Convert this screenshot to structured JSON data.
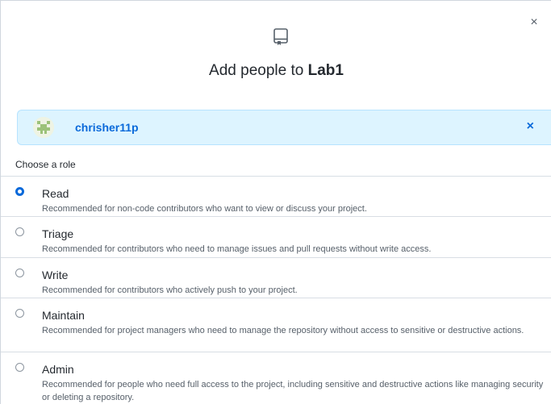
{
  "dialog": {
    "title_prefix": "Add people to ",
    "repo_name": "Lab1",
    "close_label": "×"
  },
  "selected_user": {
    "username": "chrisher11p",
    "remove_label": "×"
  },
  "role_section": {
    "heading": "Choose a role",
    "selected": "Read",
    "roles": [
      {
        "name": "Read",
        "description": "Recommended for non-code contributors who want to view or discuss your project."
      },
      {
        "name": "Triage",
        "description": "Recommended for contributors who need to manage issues and pull requests without write access."
      },
      {
        "name": "Write",
        "description": "Recommended for contributors who actively push to your project."
      },
      {
        "name": "Maintain",
        "description": "Recommended for project managers who need to manage the repository without access to sensitive or destructive actions."
      },
      {
        "name": "Admin",
        "description": "Recommended for people who need full access to the project, including sensitive and destructive actions like managing security or deleting a repository."
      }
    ]
  },
  "colors": {
    "accent": "#0969da",
    "banner_bg": "#ddf4ff",
    "banner_border": "#b6e3ff"
  },
  "icons": {
    "header": "repo-icon",
    "close": "close-icon",
    "remove": "close-icon",
    "avatar": "identicon"
  }
}
